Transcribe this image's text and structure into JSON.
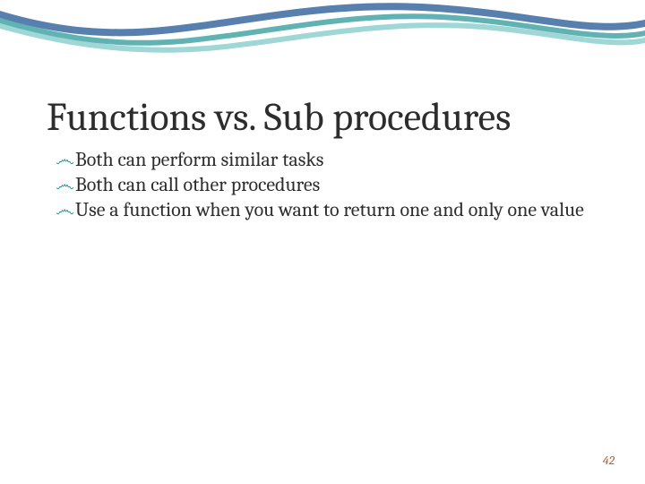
{
  "title": "Functions vs. Sub procedures",
  "bullets": [
    "Both can perform similar tasks",
    "Both can call other procedures",
    "Use a function when you want to return one and only one value"
  ],
  "bullet_glyph": "෴",
  "page_number": "42",
  "colors": {
    "accent_teal": "#2f8a8a",
    "accent_orange": "#c55a26",
    "wave_blue": "#3a6aa0",
    "wave_teal": "#3aa0a0",
    "wave_teal_light": "#6cc0c0"
  }
}
